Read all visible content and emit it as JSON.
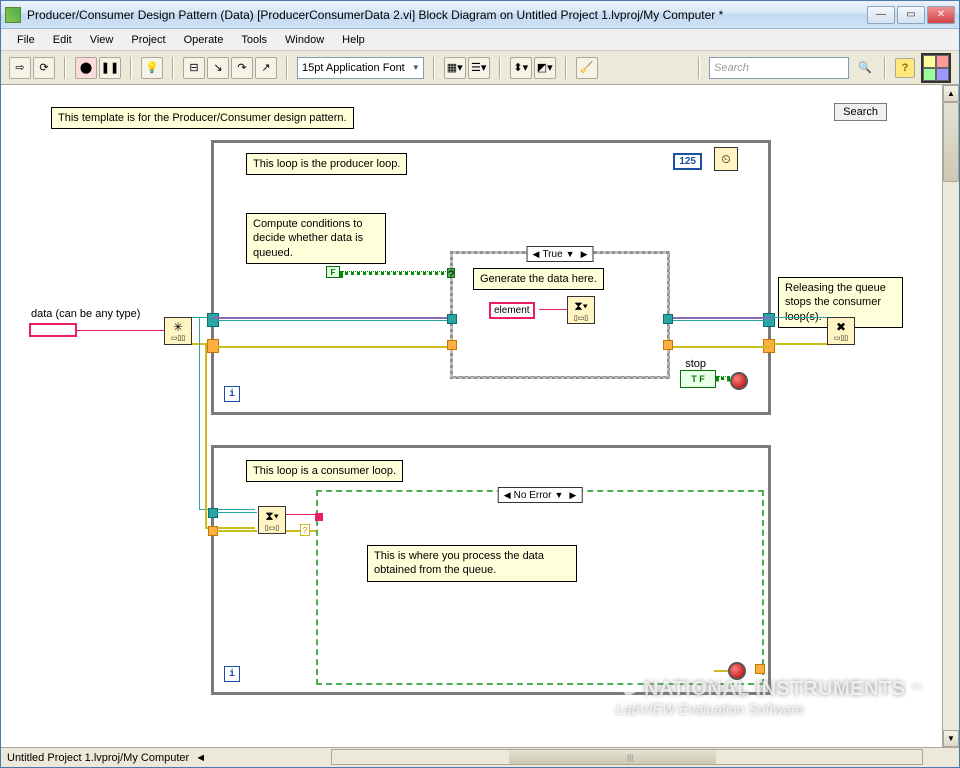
{
  "window": {
    "title": "Producer/Consumer Design Pattern (Data) [ProducerConsumerData 2.vi] Block Diagram on Untitled Project 1.lvproj/My Computer *"
  },
  "menu": {
    "items": [
      "File",
      "Edit",
      "View",
      "Project",
      "Operate",
      "Tools",
      "Window",
      "Help"
    ]
  },
  "toolbar": {
    "font": "15pt Application Font",
    "search_placeholder": "Search",
    "help_label": "?"
  },
  "canvas": {
    "template_comment": "This template is for the Producer/Consumer design pattern.",
    "search_button": "Search",
    "data_label": "data (can be any type)",
    "producer_comment": "This loop is the producer loop.",
    "compute_comment": "Compute conditions to decide whether data is queued.",
    "wait_ms": "125",
    "case_producer_selector": "True",
    "generate_comment": "Generate the data here.",
    "element_label": "element",
    "stop_label": "stop",
    "stop_tf": "T F",
    "release_comment": "Releasing the queue stops the consumer loop(s).",
    "consumer_comment": "This loop is a consumer loop.",
    "case_consumer_selector": "No Error",
    "process_comment": "This is where you process the data obtained from the queue.",
    "false_const": "F",
    "iter_label": "i"
  },
  "statusbar": {
    "path": "Untitled Project 1.lvproj/My Computer",
    "nav_indicator": "◄"
  },
  "watermark": {
    "line1": "NATIONAL INSTRUMENTS",
    "line2": "LabVIEW  Evaluation Software"
  }
}
